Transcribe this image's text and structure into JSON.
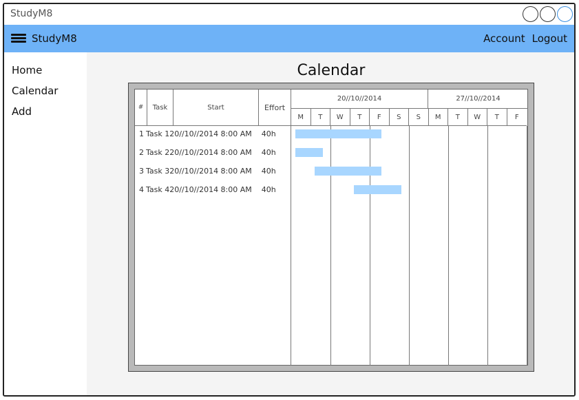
{
  "app": {
    "title": "StudyM8"
  },
  "navbar": {
    "brand": "StudyM8",
    "account": "Account",
    "logout": "Logout"
  },
  "sidebar": {
    "items": [
      {
        "label": "Home"
      },
      {
        "label": "Calendar"
      },
      {
        "label": "Add"
      }
    ]
  },
  "page": {
    "title": "Calendar"
  },
  "gantt": {
    "headers": {
      "num": "#",
      "task": "Task",
      "start": "Start",
      "effort": "Effort"
    },
    "weeks": [
      {
        "label": "20//10//2014"
      },
      {
        "label": "27//10//2014"
      }
    ],
    "days": [
      "M",
      "T",
      "W",
      "T",
      "F",
      "S",
      "S",
      "M",
      "T",
      "W",
      "T",
      "F"
    ],
    "rows": [
      {
        "num": "1",
        "task": "Task 1",
        "start": "20//10//2014 8:00 AM",
        "effort": "40h",
        "bar_start_day": 0.2,
        "bar_length_days": 4.4
      },
      {
        "num": "2",
        "task": "Task 2",
        "start": "20//10//2014 8:00 AM",
        "effort": "40h",
        "bar_start_day": 0.2,
        "bar_length_days": 1.4
      },
      {
        "num": "3",
        "task": "Task 3",
        "start": "20//10//2014 8:00 AM",
        "effort": "40h",
        "bar_start_day": 1.2,
        "bar_length_days": 3.4
      },
      {
        "num": "4",
        "task": "Task 4",
        "start": "20//10//2014 8:00 AM",
        "effort": "40h",
        "bar_start_day": 3.2,
        "bar_length_days": 2.4
      }
    ]
  }
}
